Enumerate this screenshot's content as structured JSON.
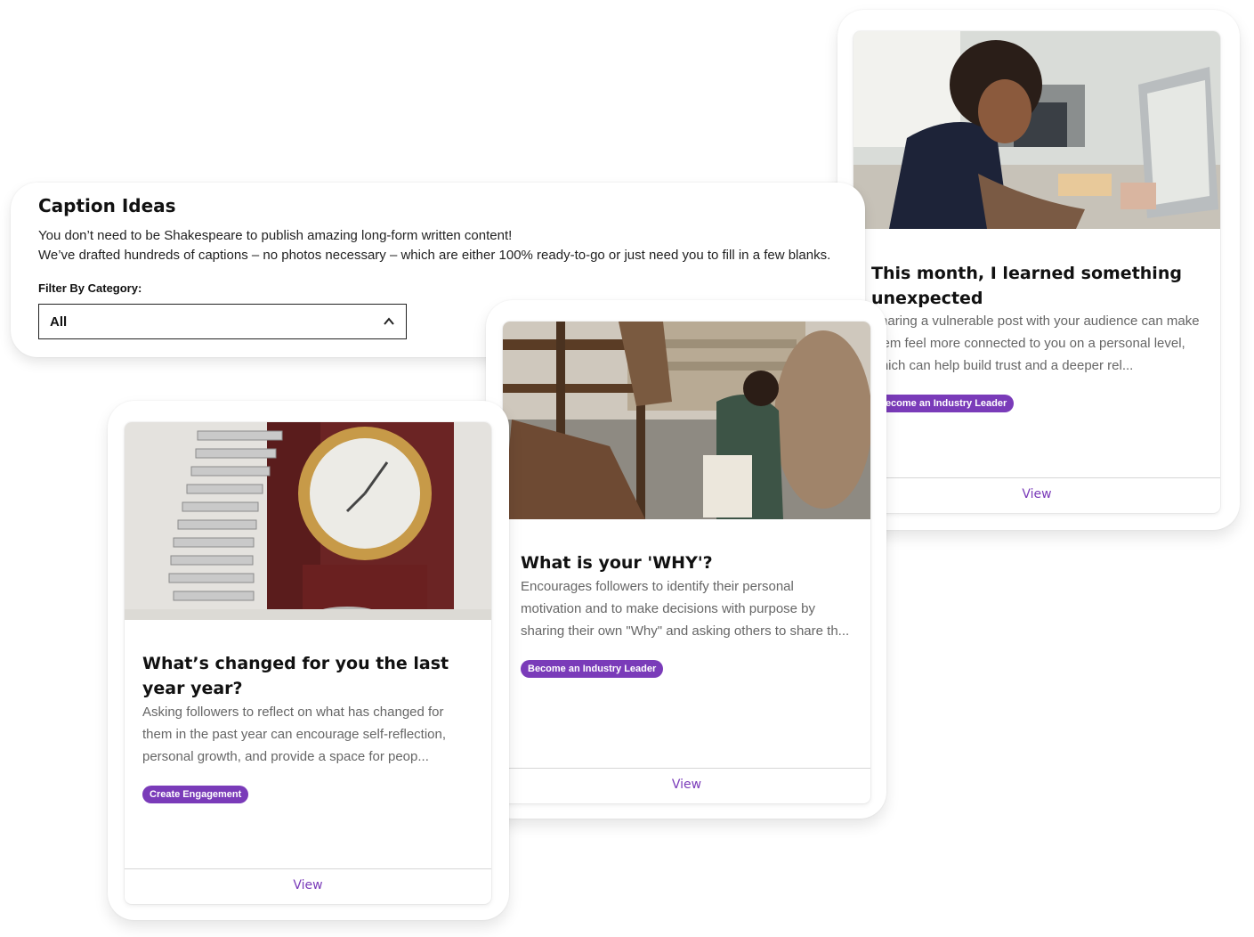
{
  "header": {
    "title": "Caption Ideas",
    "description_line1": "You don’t need to be Shakespeare to publish amazing long-form written content!",
    "description_line2": "We’ve drafted hundreds of captions – no photos necessary – which are either 100% ready-to-go or just need you to fill in a few blanks.",
    "filter_label": "Filter By Category:",
    "filter_value": "All",
    "filter_icon": "chevron-up-icon"
  },
  "cards": [
    {
      "title": "This month, I learned something unexpected",
      "description": "Sharing a vulnerable post with your audience can make them feel more connected to you on a personal level, which can help build trust and a deeper rel...",
      "tag": "Become an Industry Leader",
      "view_label": "View",
      "image": "woman working at desk with computer"
    },
    {
      "title": "What is your 'WHY'?",
      "description": "Encourages followers to identify their personal motivation and to make decisions with purpose by sharing their own \"Why\" and asking others to share th...",
      "tag": "Become an Industry Leader",
      "view_label": "View",
      "image": "man looking at phone near statues in street"
    },
    {
      "title": "What’s changed for you the last year year?",
      "description": "Asking followers to reflect on what has changed for them in the past year can encourage self-reflection, personal growth, and provide a space for peop...",
      "tag": "Create Engagement",
      "view_label": "View",
      "image": "stack of coins with clock"
    }
  ],
  "colors": {
    "accent": "#7a3bb9",
    "text": "#111111",
    "muted_text": "#666666",
    "divider": "#d6d6d6"
  }
}
